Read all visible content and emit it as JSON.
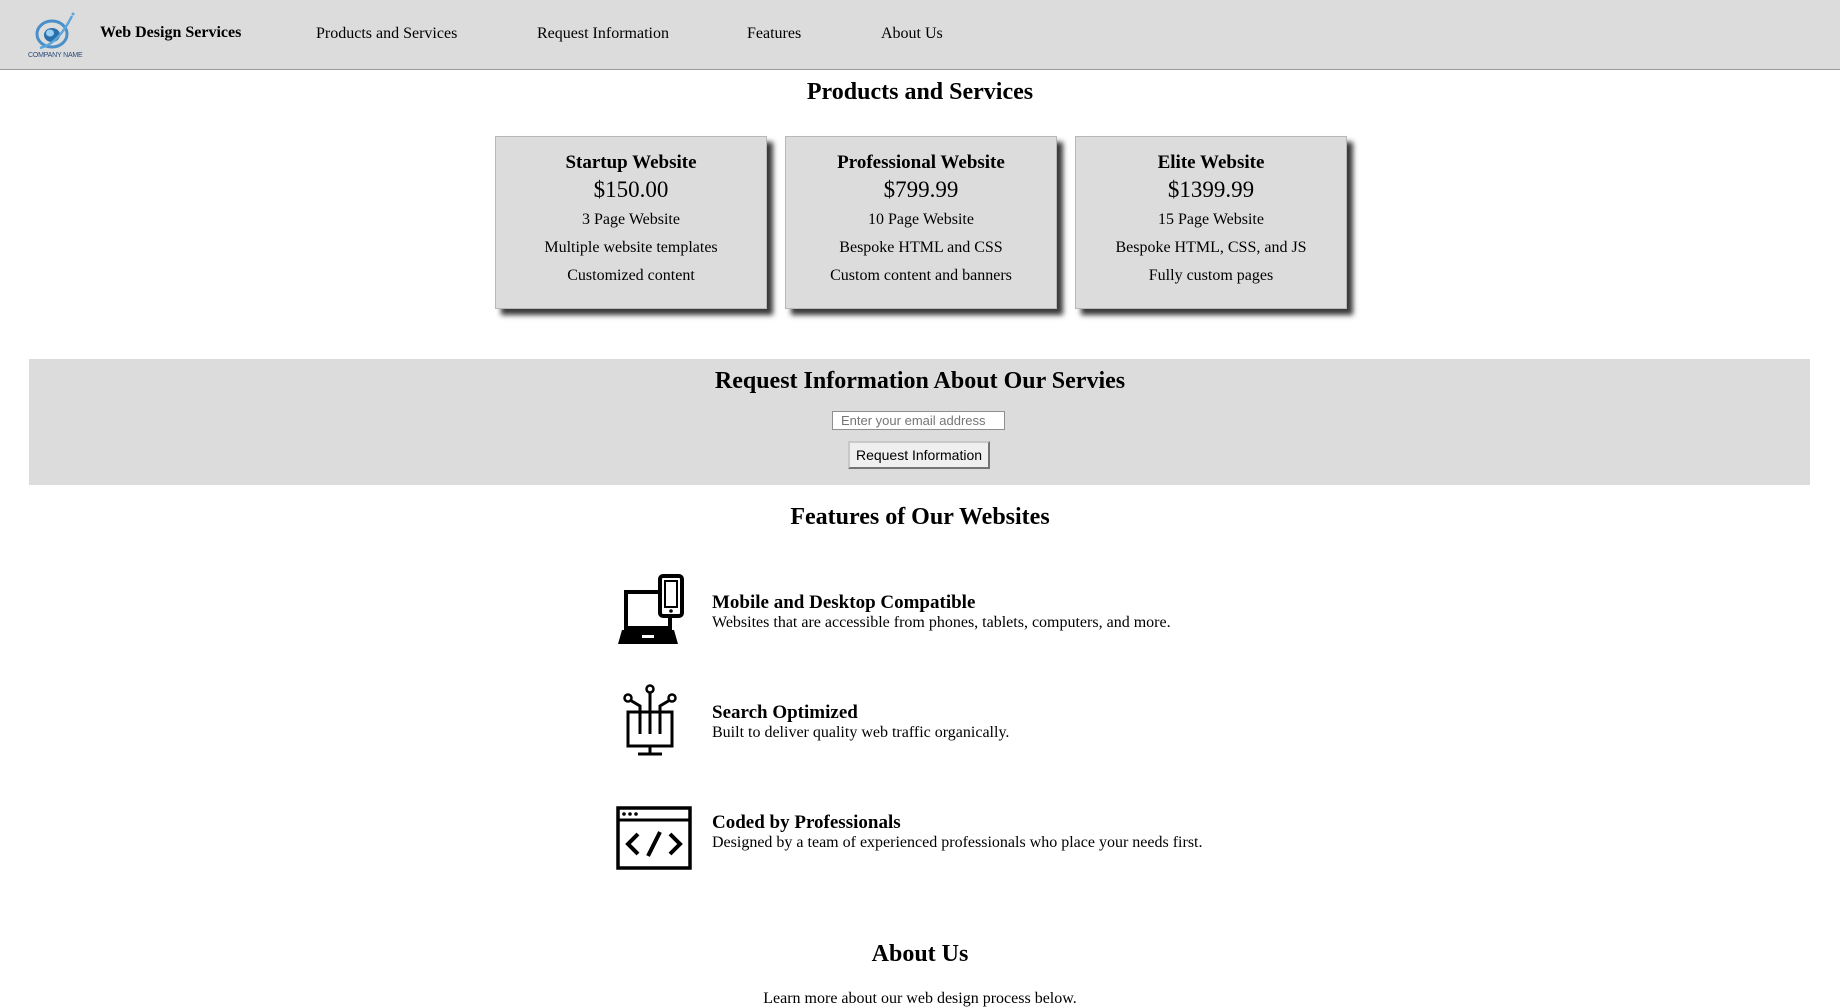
{
  "nav": {
    "logo_caption": "COMPANY NAME",
    "brand": "Web Design Services",
    "links": [
      {
        "label": "Products and Services"
      },
      {
        "label": "Request Information"
      },
      {
        "label": "Features"
      },
      {
        "label": "About Us"
      }
    ]
  },
  "products": {
    "heading": "Products and Services",
    "cards": [
      {
        "title": "Startup Website",
        "price": "$150.00",
        "features": [
          "3 Page Website",
          "Multiple website templates",
          "Customized content"
        ]
      },
      {
        "title": "Professional Website",
        "price": "$799.99",
        "features": [
          "10 Page Website",
          "Bespoke HTML and CSS",
          "Custom content and banners"
        ]
      },
      {
        "title": "Elite Website",
        "price": "$1399.99",
        "features": [
          "15 Page Website",
          "Bespoke HTML, CSS, and JS",
          "Fully custom pages"
        ]
      }
    ]
  },
  "request": {
    "heading": "Request Information About Our Servies",
    "email_placeholder": "Enter your email address",
    "button_label": "Request Information"
  },
  "features": {
    "heading": "Features of Our Websites",
    "items": [
      {
        "icon": "devices-icon",
        "title": "Mobile and Desktop Compatible",
        "description": "Websites that are accessible from phones, tablets, computers, and more."
      },
      {
        "icon": "search-optimization-icon",
        "title": "Search Optimized",
        "description": "Built to deliver quality web traffic organically."
      },
      {
        "icon": "code-window-icon",
        "title": "Coded by Professionals",
        "description": "Designed by a team of experienced professionals who place your needs first."
      }
    ]
  },
  "about": {
    "heading": "About Us",
    "text": "Learn more about our web design process below."
  }
}
